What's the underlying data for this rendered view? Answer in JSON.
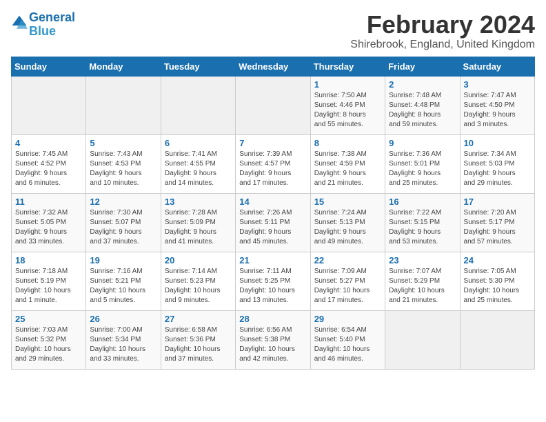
{
  "header": {
    "logo_line1": "General",
    "logo_line2": "Blue",
    "month_year": "February 2024",
    "location": "Shirebrook, England, United Kingdom"
  },
  "weekdays": [
    "Sunday",
    "Monday",
    "Tuesday",
    "Wednesday",
    "Thursday",
    "Friday",
    "Saturday"
  ],
  "weeks": [
    [
      {
        "day": "",
        "info": ""
      },
      {
        "day": "",
        "info": ""
      },
      {
        "day": "",
        "info": ""
      },
      {
        "day": "",
        "info": ""
      },
      {
        "day": "1",
        "info": "Sunrise: 7:50 AM\nSunset: 4:46 PM\nDaylight: 8 hours\nand 55 minutes."
      },
      {
        "day": "2",
        "info": "Sunrise: 7:48 AM\nSunset: 4:48 PM\nDaylight: 8 hours\nand 59 minutes."
      },
      {
        "day": "3",
        "info": "Sunrise: 7:47 AM\nSunset: 4:50 PM\nDaylight: 9 hours\nand 3 minutes."
      }
    ],
    [
      {
        "day": "4",
        "info": "Sunrise: 7:45 AM\nSunset: 4:52 PM\nDaylight: 9 hours\nand 6 minutes."
      },
      {
        "day": "5",
        "info": "Sunrise: 7:43 AM\nSunset: 4:53 PM\nDaylight: 9 hours\nand 10 minutes."
      },
      {
        "day": "6",
        "info": "Sunrise: 7:41 AM\nSunset: 4:55 PM\nDaylight: 9 hours\nand 14 minutes."
      },
      {
        "day": "7",
        "info": "Sunrise: 7:39 AM\nSunset: 4:57 PM\nDaylight: 9 hours\nand 17 minutes."
      },
      {
        "day": "8",
        "info": "Sunrise: 7:38 AM\nSunset: 4:59 PM\nDaylight: 9 hours\nand 21 minutes."
      },
      {
        "day": "9",
        "info": "Sunrise: 7:36 AM\nSunset: 5:01 PM\nDaylight: 9 hours\nand 25 minutes."
      },
      {
        "day": "10",
        "info": "Sunrise: 7:34 AM\nSunset: 5:03 PM\nDaylight: 9 hours\nand 29 minutes."
      }
    ],
    [
      {
        "day": "11",
        "info": "Sunrise: 7:32 AM\nSunset: 5:05 PM\nDaylight: 9 hours\nand 33 minutes."
      },
      {
        "day": "12",
        "info": "Sunrise: 7:30 AM\nSunset: 5:07 PM\nDaylight: 9 hours\nand 37 minutes."
      },
      {
        "day": "13",
        "info": "Sunrise: 7:28 AM\nSunset: 5:09 PM\nDaylight: 9 hours\nand 41 minutes."
      },
      {
        "day": "14",
        "info": "Sunrise: 7:26 AM\nSunset: 5:11 PM\nDaylight: 9 hours\nand 45 minutes."
      },
      {
        "day": "15",
        "info": "Sunrise: 7:24 AM\nSunset: 5:13 PM\nDaylight: 9 hours\nand 49 minutes."
      },
      {
        "day": "16",
        "info": "Sunrise: 7:22 AM\nSunset: 5:15 PM\nDaylight: 9 hours\nand 53 minutes."
      },
      {
        "day": "17",
        "info": "Sunrise: 7:20 AM\nSunset: 5:17 PM\nDaylight: 9 hours\nand 57 minutes."
      }
    ],
    [
      {
        "day": "18",
        "info": "Sunrise: 7:18 AM\nSunset: 5:19 PM\nDaylight: 10 hours\nand 1 minute."
      },
      {
        "day": "19",
        "info": "Sunrise: 7:16 AM\nSunset: 5:21 PM\nDaylight: 10 hours\nand 5 minutes."
      },
      {
        "day": "20",
        "info": "Sunrise: 7:14 AM\nSunset: 5:23 PM\nDaylight: 10 hours\nand 9 minutes."
      },
      {
        "day": "21",
        "info": "Sunrise: 7:11 AM\nSunset: 5:25 PM\nDaylight: 10 hours\nand 13 minutes."
      },
      {
        "day": "22",
        "info": "Sunrise: 7:09 AM\nSunset: 5:27 PM\nDaylight: 10 hours\nand 17 minutes."
      },
      {
        "day": "23",
        "info": "Sunrise: 7:07 AM\nSunset: 5:29 PM\nDaylight: 10 hours\nand 21 minutes."
      },
      {
        "day": "24",
        "info": "Sunrise: 7:05 AM\nSunset: 5:30 PM\nDaylight: 10 hours\nand 25 minutes."
      }
    ],
    [
      {
        "day": "25",
        "info": "Sunrise: 7:03 AM\nSunset: 5:32 PM\nDaylight: 10 hours\nand 29 minutes."
      },
      {
        "day": "26",
        "info": "Sunrise: 7:00 AM\nSunset: 5:34 PM\nDaylight: 10 hours\nand 33 minutes."
      },
      {
        "day": "27",
        "info": "Sunrise: 6:58 AM\nSunset: 5:36 PM\nDaylight: 10 hours\nand 37 minutes."
      },
      {
        "day": "28",
        "info": "Sunrise: 6:56 AM\nSunset: 5:38 PM\nDaylight: 10 hours\nand 42 minutes."
      },
      {
        "day": "29",
        "info": "Sunrise: 6:54 AM\nSunset: 5:40 PM\nDaylight: 10 hours\nand 46 minutes."
      },
      {
        "day": "",
        "info": ""
      },
      {
        "day": "",
        "info": ""
      }
    ]
  ]
}
